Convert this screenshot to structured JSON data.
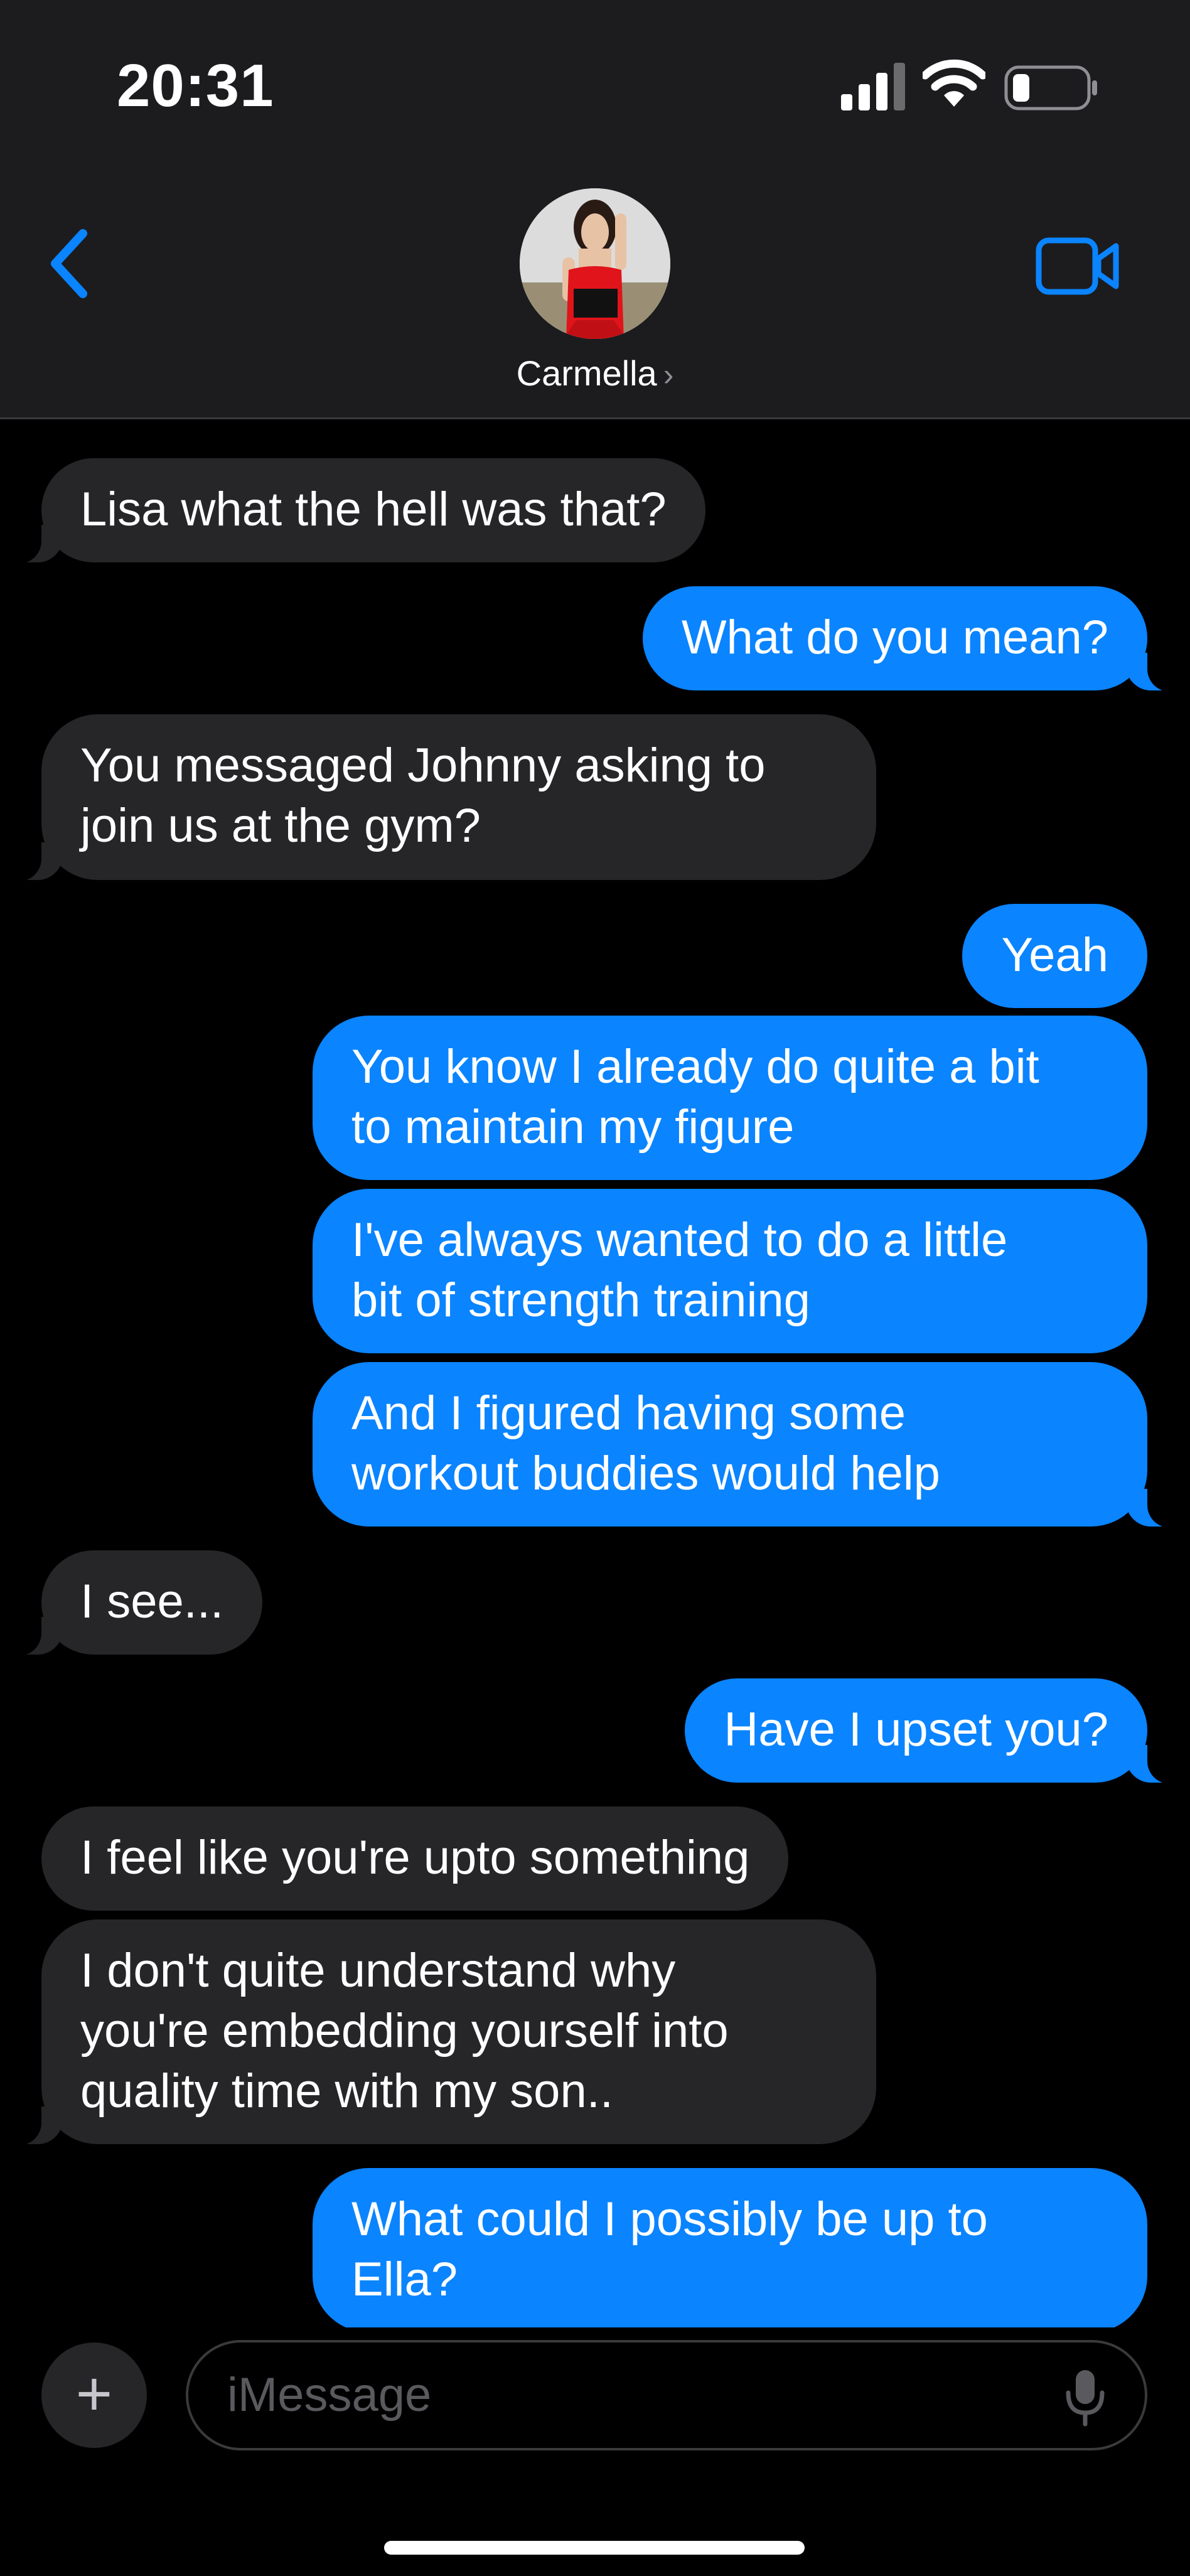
{
  "status_bar": {
    "time": "20:31"
  },
  "header": {
    "contact_name": "Carmella"
  },
  "messages": [
    {
      "side": "in",
      "text": "Lisa what the hell was that?"
    },
    {
      "side": "out",
      "text": "What do you mean?"
    },
    {
      "side": "in",
      "text": "You messaged Johnny asking to\njoin us at the gym?"
    },
    {
      "side": "out",
      "text": "Yeah"
    },
    {
      "side": "out",
      "text": "You know I already do quite a bit\nto maintain my figure"
    },
    {
      "side": "out",
      "text": "I've always wanted to do a little\nbit of strength training"
    },
    {
      "side": "out",
      "text": "And I figured having some\nworkout buddies would help"
    },
    {
      "side": "in",
      "text": "I see..."
    },
    {
      "side": "out",
      "text": "Have I upset you?"
    },
    {
      "side": "in",
      "text": "I feel like you're upto something"
    },
    {
      "side": "in",
      "text": "I don't quite understand why\nyou're embedding yourself into\nquality time with my son.."
    },
    {
      "side": "out",
      "text": "What could I possibly be up to\nElla?"
    }
  ],
  "composer": {
    "placeholder": "iMessage",
    "plus": "+"
  },
  "colors": {
    "outgoing": "#0a84ff",
    "incoming": "#262628",
    "accent": "#0a84ff"
  },
  "icons": [
    "back-chevron-icon",
    "video-camera-icon",
    "microphone-icon",
    "signal-icon",
    "wifi-icon",
    "battery-icon"
  ]
}
